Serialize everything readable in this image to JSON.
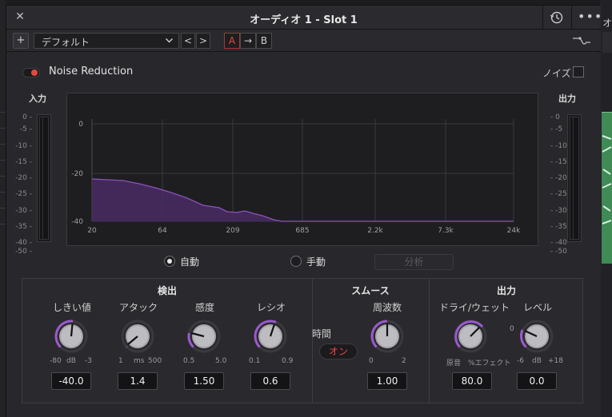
{
  "window": {
    "title": "オーディオ 1 - Slot 1"
  },
  "toolbar": {
    "add": "+",
    "preset": "デフォルト",
    "prev": "<",
    "next": ">",
    "a": "A",
    "arrow": "→",
    "b": "B"
  },
  "noise_reduction": {
    "label": "Noise Reduction",
    "enabled": true,
    "noise_label": "ノイズ"
  },
  "meters": {
    "input_title": "入力",
    "output_title": "出力",
    "scale": [
      "0",
      "-5",
      "-10",
      "-15",
      "-20",
      "-25",
      "-30",
      "-35",
      "-40",
      "-50"
    ]
  },
  "graph": {
    "y_ticks": [
      "0",
      "-20",
      "-40"
    ],
    "x_ticks": [
      "20",
      "64",
      "209",
      "685",
      "2.2k",
      "7.3k",
      "24k"
    ]
  },
  "mode": {
    "auto": "自動",
    "manual": "手動",
    "analyze": "分析",
    "selected": "auto"
  },
  "detection": {
    "title": "検出",
    "threshold": {
      "label": "しきい値",
      "min": "-80",
      "unit": "dB",
      "max": "-3",
      "value": "-40.0"
    },
    "attack": {
      "label": "アタック",
      "min": "1",
      "unit": "ms",
      "max": "500",
      "value": "1.4"
    },
    "sensitivity": {
      "label": "感度",
      "min": "0.5",
      "max": "5.0",
      "value": "1.50"
    },
    "ratio": {
      "label": "レシオ",
      "min": "0.1",
      "max": "0.9",
      "value": "0.6"
    }
  },
  "smooth": {
    "title": "スムース",
    "time_label": "時間",
    "time_toggle": "オン",
    "frequency": {
      "label": "周波数",
      "min": "0",
      "max": "2",
      "value": "1.00"
    }
  },
  "output": {
    "title": "出力",
    "drywet": {
      "label": "ドライ/ウェット",
      "min": "原音",
      "max": "%エフェクト",
      "value": "80.0"
    },
    "level": {
      "label": "レベル",
      "min": "-6",
      "unit": "dB",
      "max": "+18",
      "zero": "0",
      "value": "0.0"
    }
  },
  "background": {
    "right_title": "オ"
  },
  "colors": {
    "accent": "#e8473f",
    "knob_arc": "#9b59d0",
    "spectrum": "#6b3d8f"
  }
}
